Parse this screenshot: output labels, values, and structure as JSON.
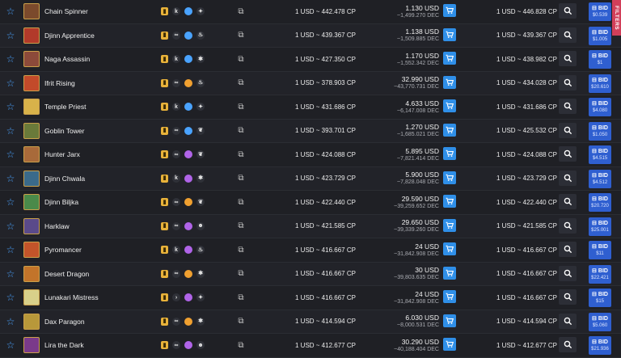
{
  "filters_label": "FILTERS",
  "bid_label": "BID",
  "rows": [
    {
      "name": "Chain Spinner",
      "el": "#4aa3ff",
      "ab": "✦",
      "pcp": "1 USD ~ 442.478 CP",
      "usd": "1.130 USD",
      "dec": "~1,499.270 DEC",
      "pcp2": "1 USD ~ 446.828 CP",
      "bid": "$0.539",
      "thumb": "#7b4a2c",
      "ed_icon": "k"
    },
    {
      "name": "Djinn Apprentice",
      "el": "#4aa3ff",
      "ab": "♨",
      "pcp": "1 USD ~ 439.367 CP",
      "usd": "1.138 USD",
      "dec": "~1,509.885 DEC",
      "pcp2": "1 USD ~ 439.367 CP",
      "bid": "$1.005",
      "thumb": "#b23a2a",
      "ed_icon": "∞"
    },
    {
      "name": "Naga Assassin",
      "el": "#4aa3ff",
      "ab": "✱",
      "pcp": "1 USD ~ 427.350 CP",
      "usd": "1.170 USD",
      "dec": "~1,552.342 DEC",
      "pcp2": "1 USD ~ 438.982 CP",
      "bid": "$1",
      "thumb": "#8c4a3a",
      "ed_icon": "k"
    },
    {
      "name": "Ifrit Rising",
      "el": "#f0a030",
      "ab": "♨",
      "pcp": "1 USD ~ 378.903 CP",
      "usd": "32.990 USD",
      "dec": "~43,770.731 DEC",
      "pcp2": "1 USD ~ 434.028 CP",
      "bid": "$20.610",
      "thumb": "#c24a2a",
      "ed_icon": "∞"
    },
    {
      "name": "Temple Priest",
      "el": "#4aa3ff",
      "ab": "✦",
      "pcp": "1 USD ~ 431.686 CP",
      "usd": "4.633 USD",
      "dec": "~6,147.008 DEC",
      "pcp2": "1 USD ~ 431.686 CP",
      "bid": "$4.080",
      "thumb": "#d8b24a",
      "ed_icon": "k"
    },
    {
      "name": "Goblin Tower",
      "el": "#4aa3ff",
      "ab": "❦",
      "pcp": "1 USD ~ 393.701 CP",
      "usd": "1.270 USD",
      "dec": "~1,685.021 DEC",
      "pcp2": "1 USD ~ 425.532 CP",
      "bid": "$1.050",
      "thumb": "#6a7a3a",
      "ed_icon": "∞"
    },
    {
      "name": "Hunter Jarx",
      "el": "#b064e8",
      "ab": "❦",
      "pcp": "1 USD ~ 424.088 CP",
      "usd": "5.895 USD",
      "dec": "~7,821.414 DEC",
      "pcp2": "1 USD ~ 424.088 CP",
      "bid": "$4.515",
      "thumb": "#a86a3a",
      "ed_icon": "∞"
    },
    {
      "name": "Djinn Chwala",
      "el": "#b064e8",
      "ab": "✱",
      "pcp": "1 USD ~ 423.729 CP",
      "usd": "5.900 USD",
      "dec": "~7,828.048 DEC",
      "pcp2": "1 USD ~ 423.729 CP",
      "bid": "$4.512",
      "thumb": "#3a6a8a",
      "ed_icon": "k"
    },
    {
      "name": "Djinn Biljka",
      "el": "#f0a030",
      "ab": "❦",
      "pcp": "1 USD ~ 422.440 CP",
      "usd": "29.590 USD",
      "dec": "~39,259.652 DEC",
      "pcp2": "1 USD ~ 422.440 CP",
      "bid": "$20.720",
      "thumb": "#4a8a4a",
      "ed_icon": "∞"
    },
    {
      "name": "Harklaw",
      "el": "#b064e8",
      "ab": "☻",
      "pcp": "1 USD ~ 421.585 CP",
      "usd": "29.650 USD",
      "dec": "~39,339.260 DEC",
      "pcp2": "1 USD ~ 421.585 CP",
      "bid": "$25.001",
      "thumb": "#5a4a8a",
      "ed_icon": "∞"
    },
    {
      "name": "Pyromancer",
      "el": "#b064e8",
      "ab": "♨",
      "pcp": "1 USD ~ 416.667 CP",
      "usd": "24 USD",
      "dec": "~31,842.908 DEC",
      "pcp2": "1 USD ~ 416.667 CP",
      "bid": "$11",
      "thumb": "#c2542a",
      "ed_icon": "k"
    },
    {
      "name": "Desert Dragon",
      "el": "#f0a030",
      "ab": "✱",
      "pcp": "1 USD ~ 416.667 CP",
      "usd": "30 USD",
      "dec": "~39,803.635 DEC",
      "pcp2": "1 USD ~ 416.667 CP",
      "bid": "$22.421",
      "thumb": "#c2742a",
      "ed_icon": "∞"
    },
    {
      "name": "Lunakari Mistress",
      "el": "#b064e8",
      "ab": "✦",
      "pcp": "1 USD ~ 416.667 CP",
      "usd": "24 USD",
      "dec": "~31,842.908 DEC",
      "pcp2": "1 USD ~ 416.667 CP",
      "bid": "$15",
      "thumb": "#d8d08a",
      "ed_icon": "›"
    },
    {
      "name": "Dax Paragon",
      "el": "#f0a030",
      "ab": "✱",
      "pcp": "1 USD ~ 414.594 CP",
      "usd": "6.030 USD",
      "dec": "~8,000.531 DEC",
      "pcp2": "1 USD ~ 414.594 CP",
      "bid": "$5.060",
      "thumb": "#b8983a",
      "ed_icon": "∞"
    },
    {
      "name": "Lira the Dark",
      "el": "#b064e8",
      "ab": "☻",
      "pcp": "1 USD ~ 412.677 CP",
      "usd": "30.290 USD",
      "dec": "~40,188.404 DEC",
      "pcp2": "1 USD ~ 412.677 CP",
      "bid": "$21.936",
      "thumb": "#7a3a8a",
      "ed_icon": "∞"
    }
  ]
}
